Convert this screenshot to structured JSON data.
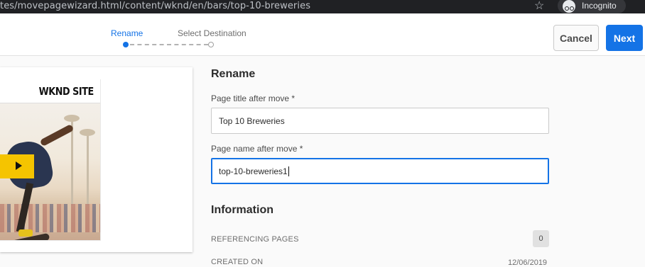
{
  "browser": {
    "url": "tes/movepagewizard.html/content/wknd/en/bars/top-10-breweries",
    "star_icon": "star-icon",
    "incognito_label": "Incognito",
    "incognito_icon": "incognito-icon"
  },
  "wizard": {
    "steps": [
      {
        "label": "Rename",
        "state": "active"
      },
      {
        "label": "Select Destination",
        "state": "inactive"
      }
    ],
    "cancel_label": "Cancel",
    "next_label": "Next",
    "accent_color": "#1473e6"
  },
  "preview": {
    "site_logo": "WKND SITE",
    "play_icon": "play-icon"
  },
  "form": {
    "section_title": "Rename",
    "title_label": "Page title after move *",
    "title_value": "Top 10 Breweries",
    "name_label": "Page name after move *",
    "name_value": "top-10-breweries1"
  },
  "information": {
    "section_title": "Information",
    "referencing_pages_label": "REFERENCING PAGES",
    "referencing_pages_count": "0",
    "created_on_label": "CREATED ON",
    "created_on_value": "12/06/2019"
  }
}
